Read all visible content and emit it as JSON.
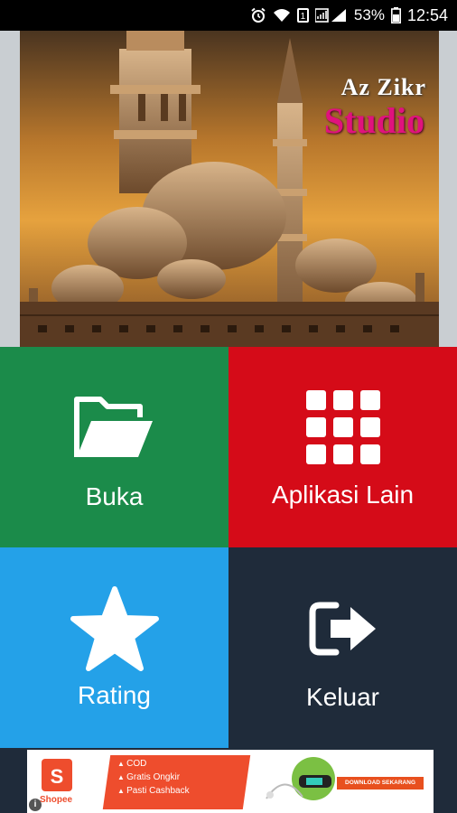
{
  "status_bar": {
    "battery_percent": "53%",
    "time": "12:54",
    "sim_number": "1"
  },
  "banner": {
    "brand_line1": "Az Zikr",
    "brand_line2": "Studio"
  },
  "menu": {
    "open_label": "Buka",
    "apps_label": "Aplikasi Lain",
    "rating_label": "Rating",
    "exit_label": "Keluar"
  },
  "colors": {
    "open_tile": "#1b8b4a",
    "apps_tile": "#d50b18",
    "rating_tile": "#24a1e8",
    "exit_tile": "#1f2b3a",
    "brand_accent": "#e0127e"
  },
  "ad": {
    "brand": "Shopee",
    "bag_letter": "S",
    "lines": [
      "COD",
      "Gratis Ongkir",
      "Pasti Cashback"
    ],
    "cta": "DOWNLOAD SEKARANG",
    "info_icon": "i"
  }
}
